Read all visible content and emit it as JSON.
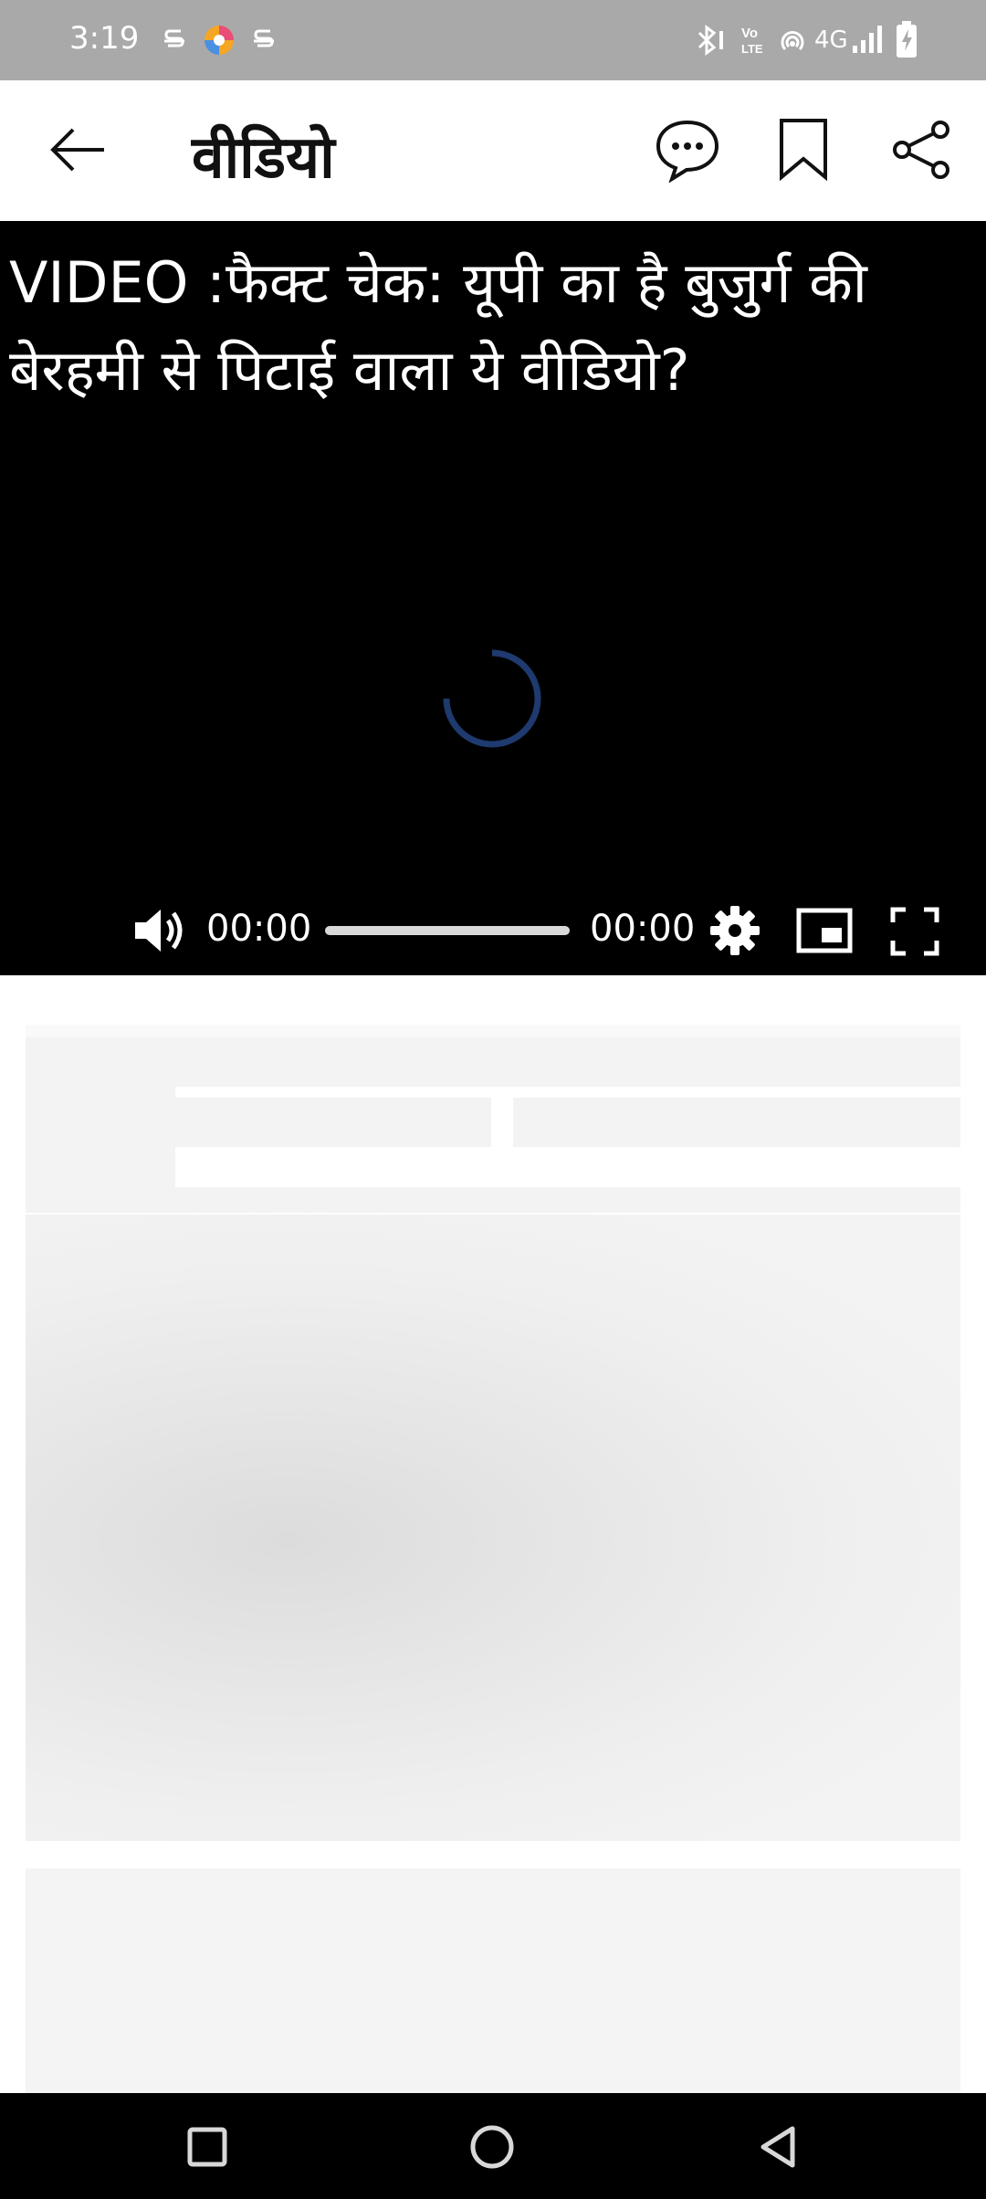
{
  "status_bar": {
    "time": "3:19",
    "network": "4G",
    "icons": [
      "s-icon",
      "app-icon",
      "s-icon",
      "bluetooth-icon",
      "volte-icon",
      "hotspot-icon",
      "signal-icon",
      "battery-charging-icon"
    ]
  },
  "app_bar": {
    "title": "वीडियो",
    "icons": [
      "back-arrow-icon",
      "comment-icon",
      "bookmark-icon",
      "share-icon"
    ]
  },
  "video": {
    "title": "VIDEO :फैक्ट चेक: यूपी का है बुजुर्ग की बेरहमी से पिटाई वाला ये वीडियो?",
    "current_time": "00:00",
    "duration": "00:00",
    "progress": 0,
    "accent_color": "#1e3a6e"
  },
  "nav_bar": {
    "icons": [
      "recents-square-icon",
      "home-circle-icon",
      "back-triangle-icon"
    ]
  }
}
